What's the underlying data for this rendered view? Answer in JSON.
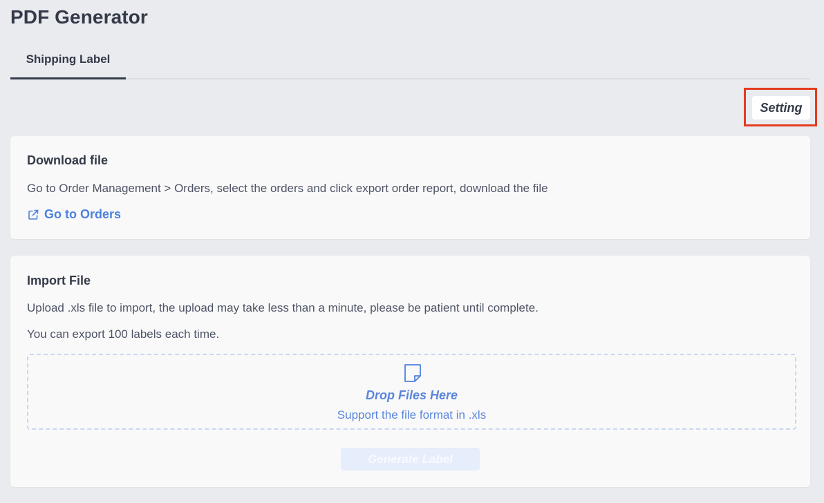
{
  "header": {
    "title": "PDF Generator"
  },
  "tabs": [
    {
      "label": "Shipping Label",
      "active": true
    }
  ],
  "toolbar": {
    "setting_label": "Setting",
    "highlight_color": "#e53a1e"
  },
  "download_section": {
    "title": "Download file",
    "description": "Go to Order Management > Orders, select the orders and click export order report, download the file",
    "link_label": "Go to Orders",
    "link_icon": "external-link-icon"
  },
  "import_section": {
    "title": "Import File",
    "description": "Upload .xls file to import, the upload may take less than a minute, please be patient until complete.",
    "limit_note": "You can export 100 labels each time.",
    "dropzone": {
      "icon": "file-icon",
      "title": "Drop Files Here",
      "subtitle": "Support the file format in .xls"
    },
    "generate_label": "Generate Label",
    "generate_disabled": true
  },
  "colors": {
    "accent": "#4d82de",
    "text_primary": "#353a48",
    "background": "#e9ebef",
    "card": "#f9f9fa"
  }
}
